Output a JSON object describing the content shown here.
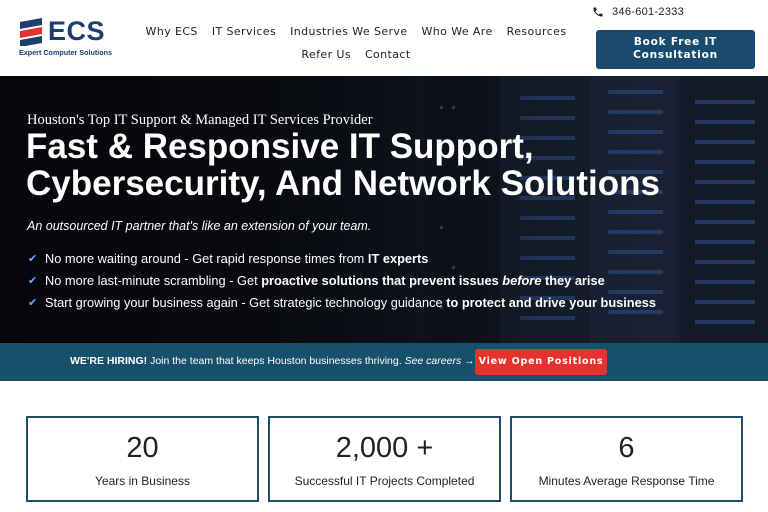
{
  "brand": {
    "name": "ECS",
    "subtitle": "Expert Computer Solutions",
    "primary_color": "#1c3f6e",
    "accent_color": "#e5322d"
  },
  "nav": {
    "row1": [
      "Why ECS",
      "IT Services",
      "Industries We Serve",
      "Who We Are",
      "Resources"
    ],
    "row2": [
      "Refer Us",
      "Contact"
    ]
  },
  "contact": {
    "phone_icon": "phone-icon",
    "phone": "346-601-2333"
  },
  "cta": {
    "book_line1": "Book Free IT",
    "book_line2": "Consultation"
  },
  "hero": {
    "eyebrow": "Houston's Top IT Support & Managed IT Services Provider",
    "headline_line1": "Fast & Responsive IT Support,",
    "headline_line2": "Cybersecurity, And Network Solutions",
    "tagline": "An outsourced IT partner that's like an extension of your team.",
    "bullets": [
      {
        "pre": "No more waiting around - Get rapid response times from ",
        "strong": "IT experts",
        "em": "",
        "post": ""
      },
      {
        "pre": "No more last-minute scrambling - Get ",
        "strong": "proactive solutions that prevent issues ",
        "em": "before",
        "post": " they arise"
      },
      {
        "pre": "Start growing your business again - Get strategic technology guidance ",
        "strong": "to protect and drive your business",
        "em": "",
        "post": ""
      }
    ]
  },
  "hiring": {
    "label": "WE'RE HIRING!",
    "text": " Join the team that keeps Houston businesses thriving. ",
    "link": "See careers →",
    "button": "View Open Positions",
    "band_color": "#17506b"
  },
  "stats": [
    {
      "value": "20",
      "label": "Years in Business"
    },
    {
      "value": "2,000 +",
      "label": "Successful IT Projects Completed"
    },
    {
      "value": "6",
      "label": "Minutes Average Response Time"
    }
  ]
}
